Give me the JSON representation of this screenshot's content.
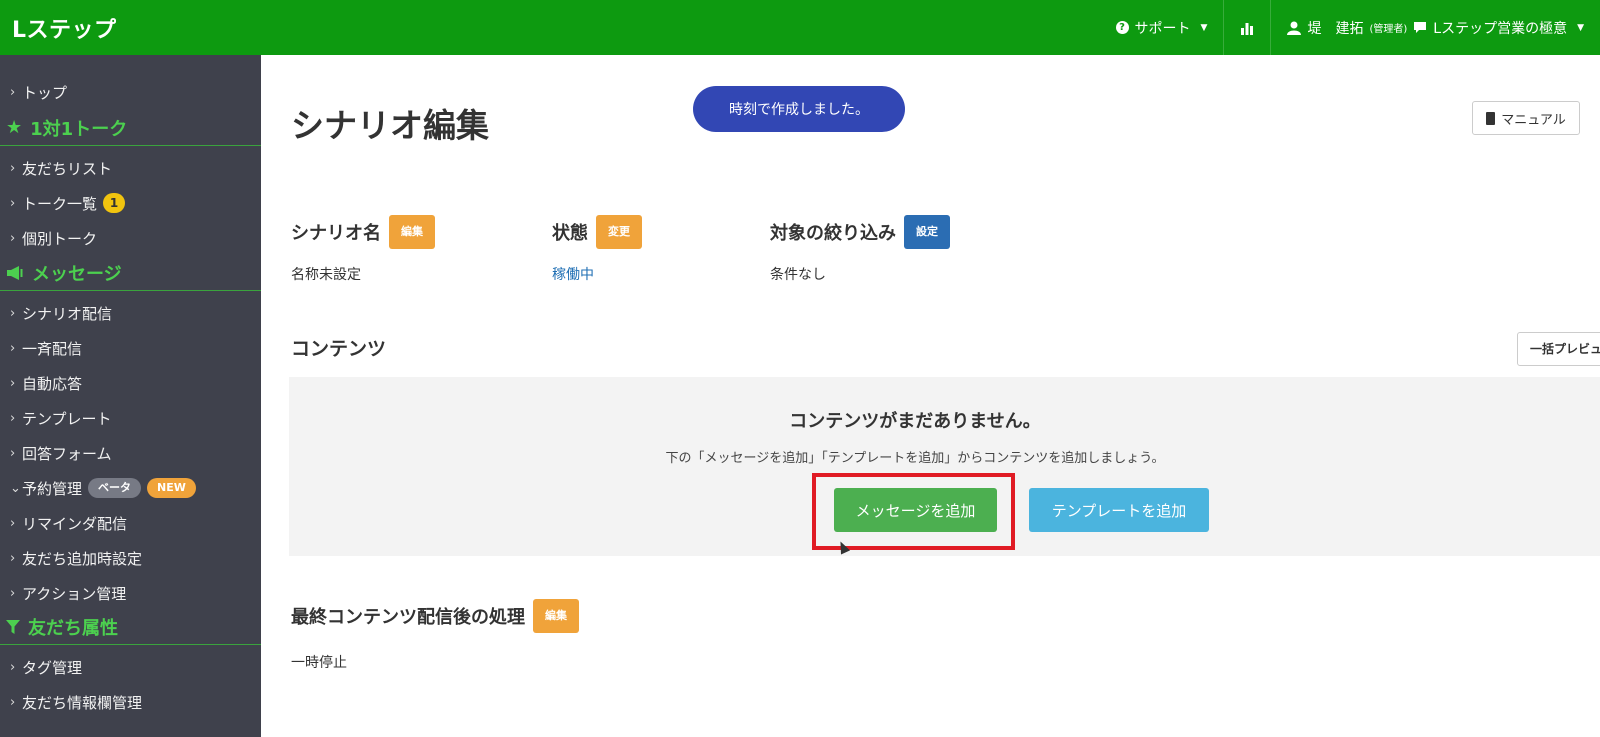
{
  "app": {
    "brand": "Lステップ"
  },
  "topnav": {
    "support": "サポート",
    "user_name": "堤　建拓",
    "user_role": "(管理者)",
    "account": "Lステップ営業の極意"
  },
  "sidebar": {
    "top": "トップ",
    "section_talk": "1対1トーク",
    "friends_list": "友だちリスト",
    "talk_list": "トーク一覧",
    "talk_badge": "1",
    "individual_talk": "個別トーク",
    "section_message": "メッセージ",
    "scenario": "シナリオ配信",
    "broadcast": "一斉配信",
    "auto_reply": "自動応答",
    "template": "テンプレート",
    "answer_form": "回答フォーム",
    "reservation": "予約管理",
    "beta_pill": "ベータ",
    "new_pill": "NEW",
    "reminder": "リマインダ配信",
    "friend_add_settings": "友だち追加時設定",
    "action_mgmt": "アクション管理",
    "section_attrs": "友だち属性",
    "tag_mgmt": "タグ管理",
    "friend_info": "友だち情報欄管理"
  },
  "main": {
    "title": "シナリオ編集",
    "toast": "時刻で作成しました。",
    "manual": "マニュアル",
    "scenario_name_label": "シナリオ名",
    "scenario_name_btn": "編集",
    "scenario_name_value": "名称未設定",
    "status_label": "状態",
    "status_btn": "変更",
    "status_value": "稼働中",
    "filter_label": "対象の絞り込み",
    "filter_btn": "設定",
    "filter_value": "条件なし",
    "contents_title": "コンテンツ",
    "preview_btn": "一括プレビュー",
    "empty_title": "コンテンツがまだありません。",
    "empty_desc": "下の「メッセージを追加」「テンプレートを追加」からコンテンツを追加しましょう。",
    "add_message": "メッセージを追加",
    "add_template": "テンプレートを追加",
    "final_label": "最終コンテンツ配信後の処理",
    "final_btn": "編集",
    "final_value": "一時停止"
  },
  "colors": {
    "topbar": "#0d9a10",
    "sidebar": "#3f414c",
    "accent_green": "#4cd04f",
    "toast": "#3247b4",
    "highlight": "#e01b24"
  }
}
